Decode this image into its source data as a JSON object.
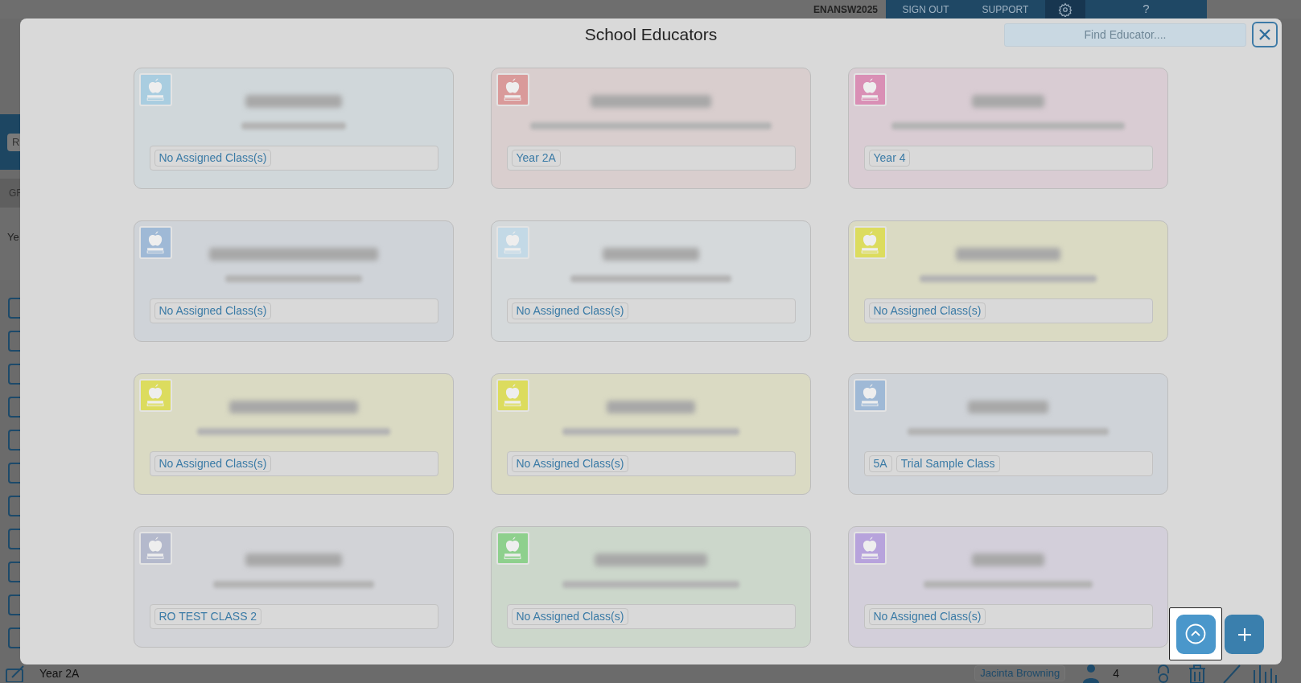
{
  "background": {
    "top_bar": {
      "account": "ENANSW2025",
      "links": [
        "SIGN OUT",
        "SUPPORT"
      ],
      "help": "?"
    },
    "side_fragments": [
      "R",
      "GF",
      "Ye"
    ],
    "bottom_bar": {
      "class_name": "Year 2A",
      "teacher": "Jacinta Browning",
      "count": "4"
    }
  },
  "dialog": {
    "title": "School Educators",
    "search": {
      "placeholder": "Find Educator...."
    },
    "educators": [
      {
        "color": "#a9cde0",
        "classes": [
          "No Assigned Class(s)"
        ]
      },
      {
        "color": "#d99a9a",
        "classes": [
          "Year 2A"
        ]
      },
      {
        "color": "#d98fb5",
        "classes": [
          "Year 4"
        ]
      },
      {
        "color": "#9fb9d6",
        "classes": [
          "No Assigned Class(s)"
        ]
      },
      {
        "color": "#c3d9e6",
        "classes": [
          "No Assigned Class(s)"
        ]
      },
      {
        "color": "#dcdc5e",
        "classes": [
          "No Assigned Class(s)"
        ]
      },
      {
        "color": "#dcdc5e",
        "classes": [
          "No Assigned Class(s)"
        ]
      },
      {
        "color": "#dcdc5e",
        "classes": [
          "No Assigned Class(s)"
        ]
      },
      {
        "color": "#9fb9d6",
        "classes": [
          "5A",
          "Trial Sample Class"
        ]
      },
      {
        "color": "#b4b9cc",
        "classes": [
          "RO TEST CLASS 2"
        ]
      },
      {
        "color": "#8ed08d",
        "classes": [
          "No Assigned Class(s)"
        ]
      },
      {
        "color": "#b7a3dc",
        "classes": [
          "No Assigned Class(s)"
        ]
      }
    ]
  }
}
